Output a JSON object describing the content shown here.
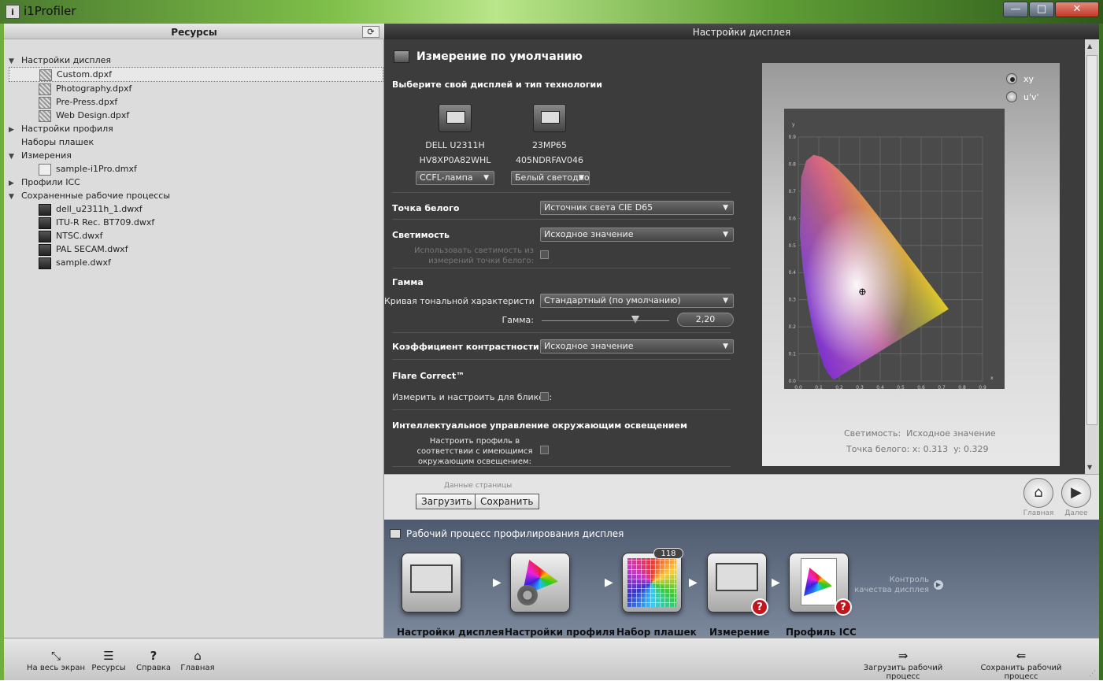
{
  "app": {
    "title": "i1Profiler",
    "icon": "i1-logo-icon"
  },
  "window_controls": {
    "minimize": "—",
    "maximize": "□",
    "close": "✕"
  },
  "left": {
    "header": "Ресурсы",
    "refresh_icon": "⟳",
    "tree": [
      {
        "level": 0,
        "arrow": "▼",
        "label": "Настройки дисплея"
      },
      {
        "level": 1,
        "icon": "dpxf",
        "label": "Custom.dpxf",
        "selected": true
      },
      {
        "level": 1,
        "icon": "dpxf",
        "label": "Photography.dpxf"
      },
      {
        "level": 1,
        "icon": "dpxf",
        "label": "Pre-Press.dpxf"
      },
      {
        "level": 1,
        "icon": "dpxf",
        "label": "Web Design.dpxf"
      },
      {
        "level": 0,
        "arrow": "▶",
        "label": "Настройки профиля"
      },
      {
        "level": 0,
        "arrow": "",
        "label": "Наборы плашек"
      },
      {
        "level": 0,
        "arrow": "▼",
        "label": "Измерения"
      },
      {
        "level": 1,
        "icon": "dmxf",
        "label": "sample-i1Pro.dmxf"
      },
      {
        "level": 0,
        "arrow": "▶",
        "label": "Профили ICC"
      },
      {
        "level": 0,
        "arrow": "▼",
        "label": "Сохраненные рабочие процессы"
      },
      {
        "level": 1,
        "icon": "dwxf",
        "label": "dell_u2311h_1.dwxf"
      },
      {
        "level": 1,
        "icon": "dwxf",
        "label": "ITU-R Rec. BT709.dwxf"
      },
      {
        "level": 1,
        "icon": "dwxf",
        "label": "NTSC.dwxf"
      },
      {
        "level": 1,
        "icon": "dwxf",
        "label": "PAL SECAM.dwxf"
      },
      {
        "level": 1,
        "icon": "dwxf",
        "label": "sample.dwxf"
      }
    ]
  },
  "right": {
    "header": "Настройки дисплея",
    "section_title": "Измерение по умолчанию",
    "choose_display": "Выберите свой дисплей и тип технологии",
    "displays": [
      {
        "name": "DELL U2311H",
        "serial": "HV8XP0A82WHL",
        "tech": "CCFL-лампа"
      },
      {
        "name": "23MP65",
        "serial": "405NDRFAV046",
        "tech": "Белый светодиод"
      }
    ],
    "white_point": {
      "label": "Точка белого",
      "value": "Источник света CIE D65"
    },
    "luminance": {
      "label": "Светимость",
      "value": "Исходное значение",
      "sub": "Использовать светимость из измерений точки белого:"
    },
    "gamma": {
      "title": "Гамма",
      "curve_label": "Кривая тональной характеристики:",
      "curve_value": "Стандартный (по умолчанию)",
      "gamma_label": "Гамма:",
      "gamma_value": "2,20",
      "slider_fraction": 0.75
    },
    "contrast": {
      "label": "Коэффициент контрастности",
      "value": "Исходное значение"
    },
    "flare": {
      "title": "Flare Correct™",
      "label": "Измерить и настроить для бликов:"
    },
    "ambient": {
      "title": "Интеллектуальное управление окружающим освещением",
      "label": "Настроить профиль в соответствии с имеющимся окружающим освещением:"
    },
    "diagram": {
      "modes": [
        "xy",
        "u'v'"
      ],
      "selected_mode": "xy",
      "y_axis": "y",
      "x_axis": "x",
      "y_ticks": [
        "0.9",
        "0.8",
        "0.7",
        "0.6",
        "0.5",
        "0.4",
        "0.3",
        "0.2",
        "0.1",
        "0.0"
      ],
      "x_ticks": [
        "0.0",
        "0.1",
        "0.2",
        "0.3",
        "0.4",
        "0.5",
        "0.6",
        "0.7",
        "0.8",
        "0.9"
      ],
      "white_point_xy": [
        0.313,
        0.329
      ],
      "status_luminance_label": "Светимость:",
      "status_luminance_value": "Исходное значение",
      "status_white_label": "Точка белого:",
      "status_white_x": "x: 0.313",
      "status_white_y": "y: 0.329"
    }
  },
  "footer": {
    "page_data": "Данные страницы",
    "load": "Загрузить",
    "save": "Сохранить",
    "home": "Главная",
    "next": "Далее",
    "home_icon": "⌂",
    "next_icon": "▶"
  },
  "workflow": {
    "title": "Рабочий процесс профилирования дисплея",
    "steps": [
      {
        "label": "Настройки дисплея"
      },
      {
        "label": "Настройки профиля"
      },
      {
        "label": "Набор плашек",
        "badge": "118"
      },
      {
        "label": "Измерение"
      },
      {
        "label": "Профиль ICC"
      }
    ],
    "qa": "Контроль качества дисплея"
  },
  "bottom": {
    "fullscreen": "На весь экран",
    "resources": "Ресурсы",
    "help": "Справка",
    "home": "Главная",
    "load_wf": "Загрузить рабочий процесс",
    "save_wf": "Сохранить рабочий процесс"
  }
}
